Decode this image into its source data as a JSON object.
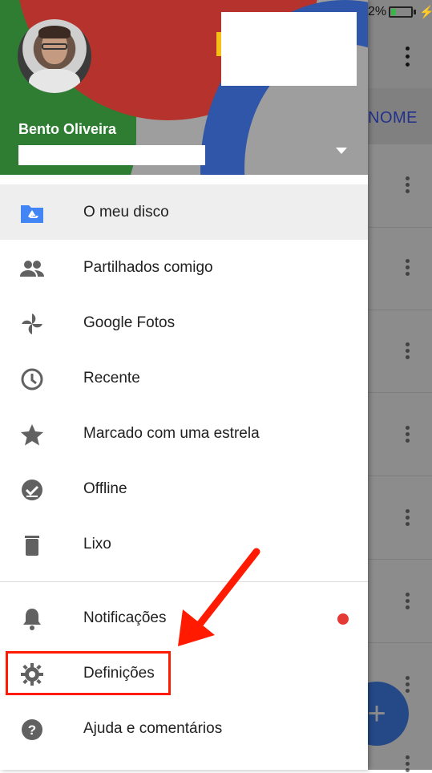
{
  "status_bar": {
    "battery_percent": "2%",
    "battery_level": 0.22
  },
  "background_app": {
    "sort_label": "NOME",
    "fab_label": "+"
  },
  "drawer": {
    "account": {
      "name": "Bento Oliveira"
    },
    "menu_items": [
      {
        "label": "O meu disco",
        "icon": "drive-folder-icon",
        "active": true
      },
      {
        "label": "Partilhados comigo",
        "icon": "people-icon"
      },
      {
        "label": "Google Fotos",
        "icon": "google-photos-icon"
      },
      {
        "label": "Recente",
        "icon": "clock-icon"
      },
      {
        "label": "Marcado com uma estrela",
        "icon": "star-icon"
      },
      {
        "label": "Offline",
        "icon": "offline-check-icon"
      },
      {
        "label": "Lixo",
        "icon": "trash-icon"
      }
    ],
    "secondary_items": [
      {
        "label": "Notificações",
        "icon": "bell-icon",
        "has_badge": true
      },
      {
        "label": "Definições",
        "icon": "gear-icon"
      },
      {
        "label": "Ajuda e comentários",
        "icon": "help-icon"
      }
    ]
  },
  "colors": {
    "accent": "#4285f4",
    "notification_badge": "#e53935",
    "annotation": "#ff1a00"
  }
}
